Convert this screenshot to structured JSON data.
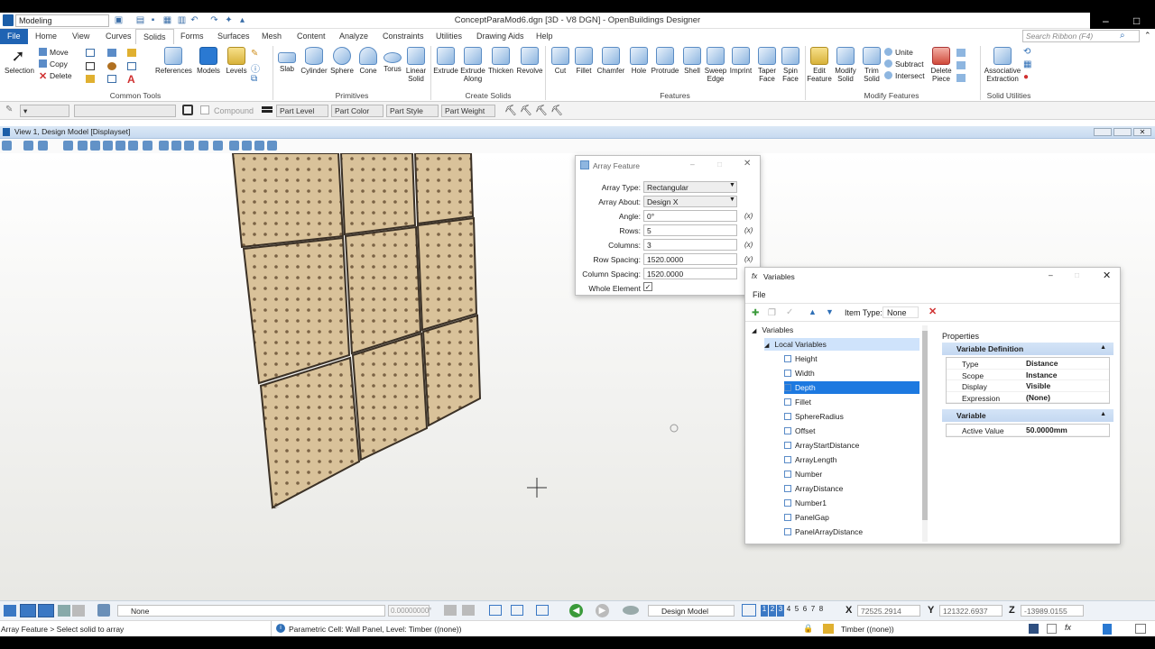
{
  "window": {
    "workspace": "Modeling",
    "title": "ConceptParaMod6.dgn [3D - V8 DGN] - OpenBuildings Designer"
  },
  "tabs": [
    "File",
    "Home",
    "View",
    "Curves",
    "Solids",
    "Forms",
    "Surfaces",
    "Mesh",
    "Content",
    "Analyze",
    "Constraints",
    "Utilities",
    "Drawing Aids",
    "Help"
  ],
  "search_placeholder": "Search Ribbon (F4)",
  "ribbon": {
    "common_tools": {
      "label": "Common Tools",
      "selection": "Selection",
      "move": "Move",
      "copy": "Copy",
      "delete": "Delete",
      "references": "References",
      "models": "Models",
      "levels": "Levels"
    },
    "primitives": {
      "label": "Primitives",
      "items": [
        "Slab",
        "Cylinder",
        "Sphere",
        "Cone",
        "Torus",
        "Linear Solid"
      ]
    },
    "create_solids": {
      "label": "Create Solids",
      "items": [
        "Extrude",
        "Extrude Along",
        "Thicken",
        "Revolve"
      ]
    },
    "features": {
      "label": "Features",
      "items": [
        "Cut",
        "Fillet",
        "Chamfer",
        "Hole",
        "Protrude",
        "Shell",
        "Sweep Edge",
        "Imprint",
        "Taper Face",
        "Spin Face"
      ]
    },
    "modify_features": {
      "label": "Modify Features",
      "items": [
        "Edit Feature",
        "Modify Solid",
        "Trim Solid"
      ],
      "small": [
        "Unite",
        "Subtract",
        "Intersect"
      ],
      "delete_piece": "Delete Piece"
    },
    "solid_utilities": {
      "label": "Solid Utilities",
      "assoc": "Associative Extraction"
    }
  },
  "attrbar": {
    "compound": "Compound",
    "part_level": "Part Level",
    "part_color": "Part Color",
    "part_style": "Part Style",
    "part_weight": "Part Weight"
  },
  "view": {
    "title": "View 1, Design Model [Displayset]"
  },
  "array_dialog": {
    "title": "Array  Feature",
    "fields": [
      {
        "label": "Array Type:",
        "value": "Rectangular",
        "kind": "dropdown"
      },
      {
        "label": "Array About:",
        "value": "Design X",
        "kind": "dropdown"
      },
      {
        "label": "Angle:",
        "value": "0°",
        "kind": "text",
        "fx": "(x)"
      },
      {
        "label": "Rows:",
        "value": "5",
        "kind": "text",
        "fx": "(x)"
      },
      {
        "label": "Columns:",
        "value": "3",
        "kind": "text",
        "fx": "(x)"
      },
      {
        "label": "Row Spacing:",
        "value": "1520.0000",
        "kind": "text",
        "fx": "(x)"
      },
      {
        "label": "Column Spacing:",
        "value": "1520.0000",
        "kind": "text",
        "fx": "(x)"
      }
    ],
    "whole_element": "Whole Element",
    "whole_element_checked": true
  },
  "variables_dialog": {
    "title": "Variables",
    "menu_file": "File",
    "item_type_label": "Item Type:",
    "item_type_value": "None",
    "tree_root": "Variables",
    "tree_local": "Local Variables",
    "variables": [
      "Height",
      "Width",
      "Depth",
      "Fillet",
      "SphereRadius",
      "Offset",
      "ArrayStartDistance",
      "ArrayLength",
      "Number",
      "ArrayDistance",
      "Number1",
      "PanelGap",
      "PanelArrayDistance"
    ],
    "selected": "Depth",
    "properties_label": "Properties",
    "var_def_header": "Variable Definition",
    "var_def": [
      {
        "k": "Type",
        "v": "Distance"
      },
      {
        "k": "Scope",
        "v": "Instance"
      },
      {
        "k": "Display",
        "v": "Visible"
      },
      {
        "k": "Expression",
        "v": "(None)"
      }
    ],
    "variable_header": "Variable",
    "active_value_label": "Active Value",
    "active_value": "50.0000mm"
  },
  "statusbar": {
    "level": "None",
    "angle": "0.00000000°",
    "model": "Design Model",
    "views": [
      "1",
      "2",
      "3",
      "4",
      "5",
      "6",
      "7",
      "8"
    ],
    "x": "72525.2914",
    "y": "121322.6937",
    "z": "-13989.0155",
    "prompt": "Array  Feature > Select solid to array",
    "message": "Parametric Cell: Wall Panel, Level: Timber ((none))",
    "level_display": "Timber ((none))"
  },
  "colors": {
    "accent": "#1f63b3",
    "selection": "#1d79e0",
    "panel": "#d9c29a"
  }
}
